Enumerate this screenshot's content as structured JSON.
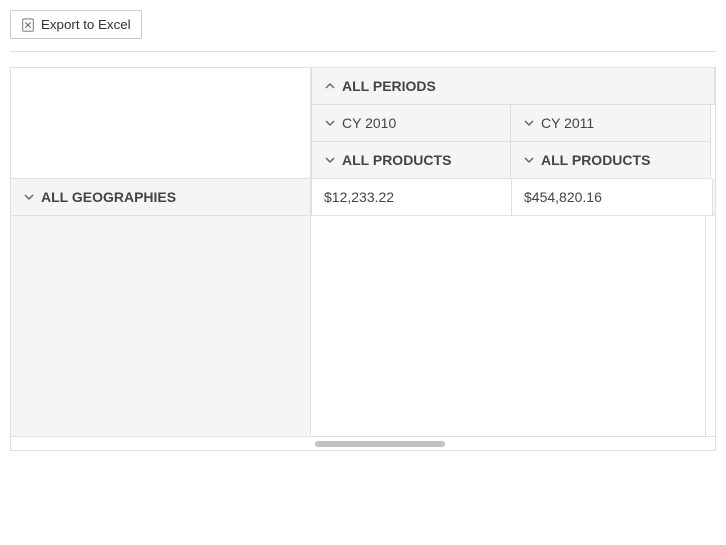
{
  "export": {
    "label": "Export to Excel"
  },
  "pivot": {
    "colHeaders": {
      "allPeriods": "ALL PERIODS",
      "periods": [
        {
          "label": "CY 2010",
          "subLabel": "ALL PRODUCTS"
        },
        {
          "label": "CY 2011",
          "subLabel": "ALL PRODUCTS"
        }
      ]
    },
    "rowHeaders": {
      "allGeographies": "ALL GEOGRAPHIES"
    },
    "data": {
      "row0": {
        "col0": "$12,233.22",
        "col1": "$454,820.16"
      }
    }
  }
}
